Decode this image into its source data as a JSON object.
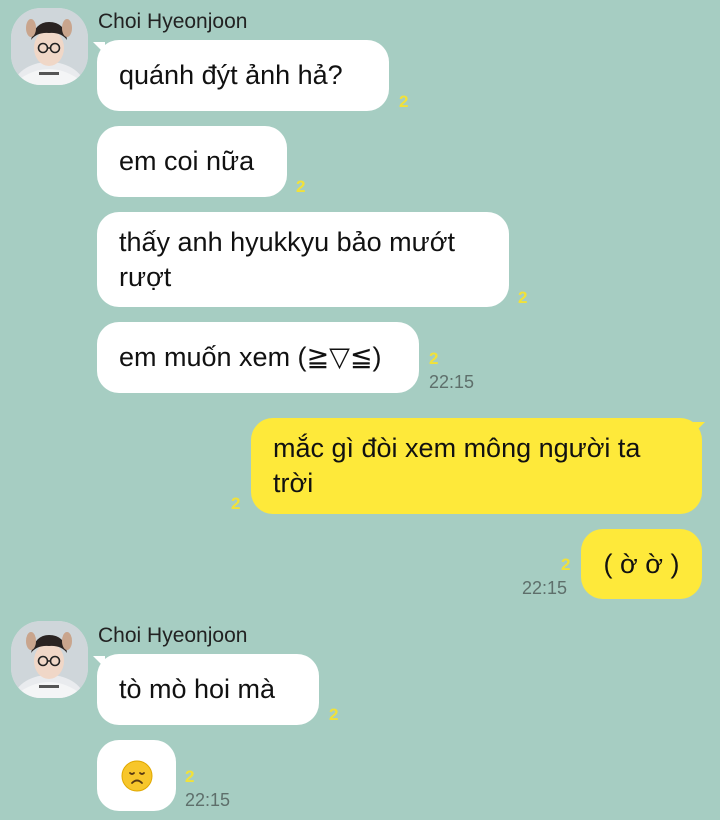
{
  "chat": {
    "group1": {
      "sender_name": "Choi Hyeonjoon",
      "messages": [
        {
          "text": "quánh đýt ảnh hả?",
          "unread": "2"
        },
        {
          "text": "em coi nữa",
          "unread": "2"
        },
        {
          "text": "thấy anh hyukkyu bảo mướt rượt",
          "unread": "2"
        },
        {
          "text": "em muốn xem (≧▽≦)",
          "unread": "2",
          "time": "22:15"
        }
      ]
    },
    "my_messages": [
      {
        "text": "mắc gì đòi xem mông người ta trời",
        "unread": "2"
      },
      {
        "text": "( ờ ờ )",
        "unread": "2",
        "time": "22:15"
      }
    ],
    "group2": {
      "sender_name": "Choi Hyeonjoon",
      "messages": [
        {
          "text": "tò mò hoi mà",
          "unread": "2"
        },
        {
          "emoji": "disappointed-face-emoji",
          "unread": "2",
          "time": "22:15"
        }
      ]
    }
  },
  "colors": {
    "background": "#a6cdc2",
    "incoming_bubble": "#ffffff",
    "outgoing_bubble": "#fee93a",
    "unread_count": "#f1e13a",
    "timestamp": "#5e6f6b"
  }
}
